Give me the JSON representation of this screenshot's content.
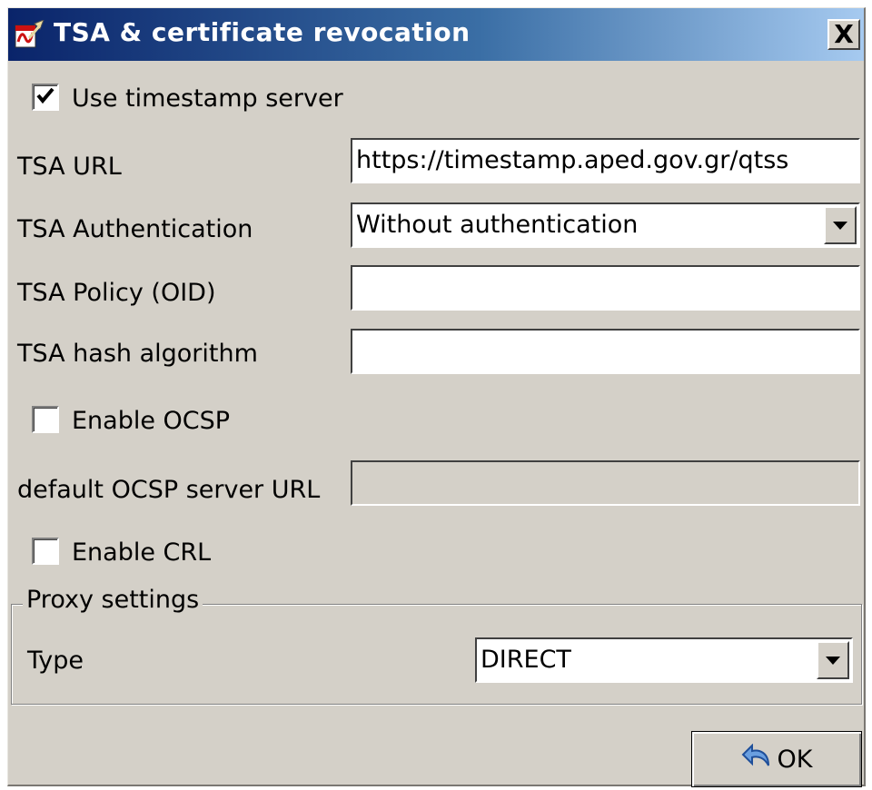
{
  "window": {
    "title": "TSA & certificate revocation",
    "close_label": "X",
    "title_icon": "pdf-sign-icon"
  },
  "timestamp": {
    "use_label": "Use timestamp server",
    "use_checked": true,
    "url_label": "TSA URL",
    "url_value": "https://timestamp.aped.gov.gr/qtss",
    "auth_label": "TSA Authentication",
    "auth_value": "Without authentication",
    "policy_label": "TSA Policy (OID)",
    "policy_value": "",
    "hash_label": "TSA hash algorithm",
    "hash_value": ""
  },
  "ocsp": {
    "enable_label": "Enable OCSP",
    "enabled": false,
    "url_label": "default OCSP server URL",
    "url_value": ""
  },
  "crl": {
    "enable_label": "Enable CRL",
    "enabled": false
  },
  "proxy": {
    "group_label": "Proxy settings",
    "type_label": "Type",
    "type_value": "DIRECT"
  },
  "actions": {
    "ok_label": "OK",
    "ok_icon": "undo-arrow-icon"
  },
  "colors": {
    "title_start": "#0a246a",
    "title_end": "#a6caf0",
    "window_bg": "#d4d0c8"
  }
}
